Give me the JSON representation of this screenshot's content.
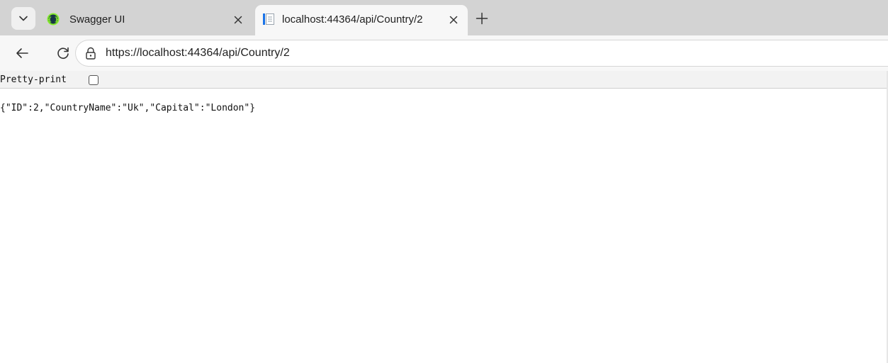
{
  "colors": {
    "tabstrip_bg": "#d3d3d3",
    "active_tab_bg": "#f7f7f7",
    "swagger_green": "#85ea2d",
    "file_icon_blue": "#1a73e8"
  },
  "icons": {
    "tab_menu": "chevron-down-icon",
    "tab1_favicon": "swagger-logo-icon",
    "tab2_favicon": "document-icon",
    "close": "close-icon",
    "new_tab": "plus-icon",
    "back": "back-arrow-icon",
    "reload": "reload-icon",
    "site_info": "lock-icon"
  },
  "tabs": [
    {
      "title": "Swagger UI",
      "active": false
    },
    {
      "title": "localhost:44364/api/Country/2",
      "active": true
    }
  ],
  "toolbar": {
    "url": "https://localhost:44364/api/Country/2"
  },
  "viewer": {
    "pretty_print_label": "Pretty-print",
    "pretty_print_checked": false,
    "json_text": "{\"ID\":2,\"CountryName\":\"Uk\",\"Capital\":\"London\"}"
  }
}
